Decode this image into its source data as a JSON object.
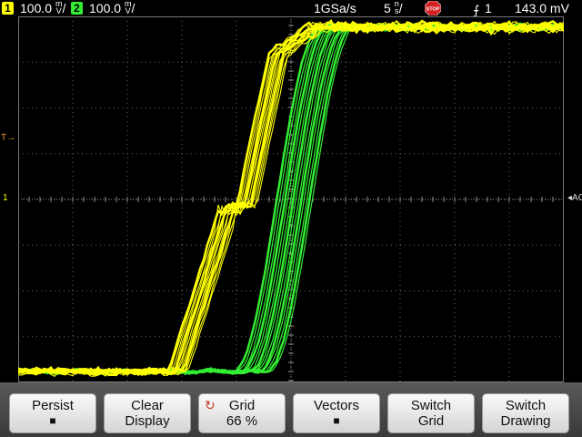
{
  "status": {
    "ch1_badge": "1",
    "ch1_scale": "100.0",
    "ch1_unit_top": "m",
    "ch1_unit_bot": "V",
    "ch2_badge": "2",
    "ch2_scale": "100.0",
    "ch2_unit_top": "m",
    "ch2_unit_bot": "V",
    "sample_rate": "1GSa/s",
    "time_scale": "5",
    "time_unit_top": "n",
    "time_unit_bot": "s",
    "stop_label": "STOP",
    "trigger_channel": "1",
    "trigger_level": "143.0 mV"
  },
  "markers": {
    "trigger_top": "T",
    "trigger_level_left": "T",
    "ch_ground_left": "1",
    "ac_right": "AC"
  },
  "softkeys": {
    "persist": {
      "line1": "Persist",
      "symbol": "■"
    },
    "clear_display": {
      "line1": "Clear",
      "line2": "Display"
    },
    "grid": {
      "line1": "Grid",
      "line2": "66 %"
    },
    "vectors": {
      "line1": "Vectors",
      "symbol": "■"
    },
    "switch_grid": {
      "line1": "Switch",
      "line2": "Grid"
    },
    "switch_drawing": {
      "line1": "Switch",
      "line2": "Drawing"
    }
  },
  "colors": {
    "ch1": "#ffff00",
    "ch2": "#33ee33",
    "grid": "#6a6a6a",
    "marker": "#f0a030"
  }
}
